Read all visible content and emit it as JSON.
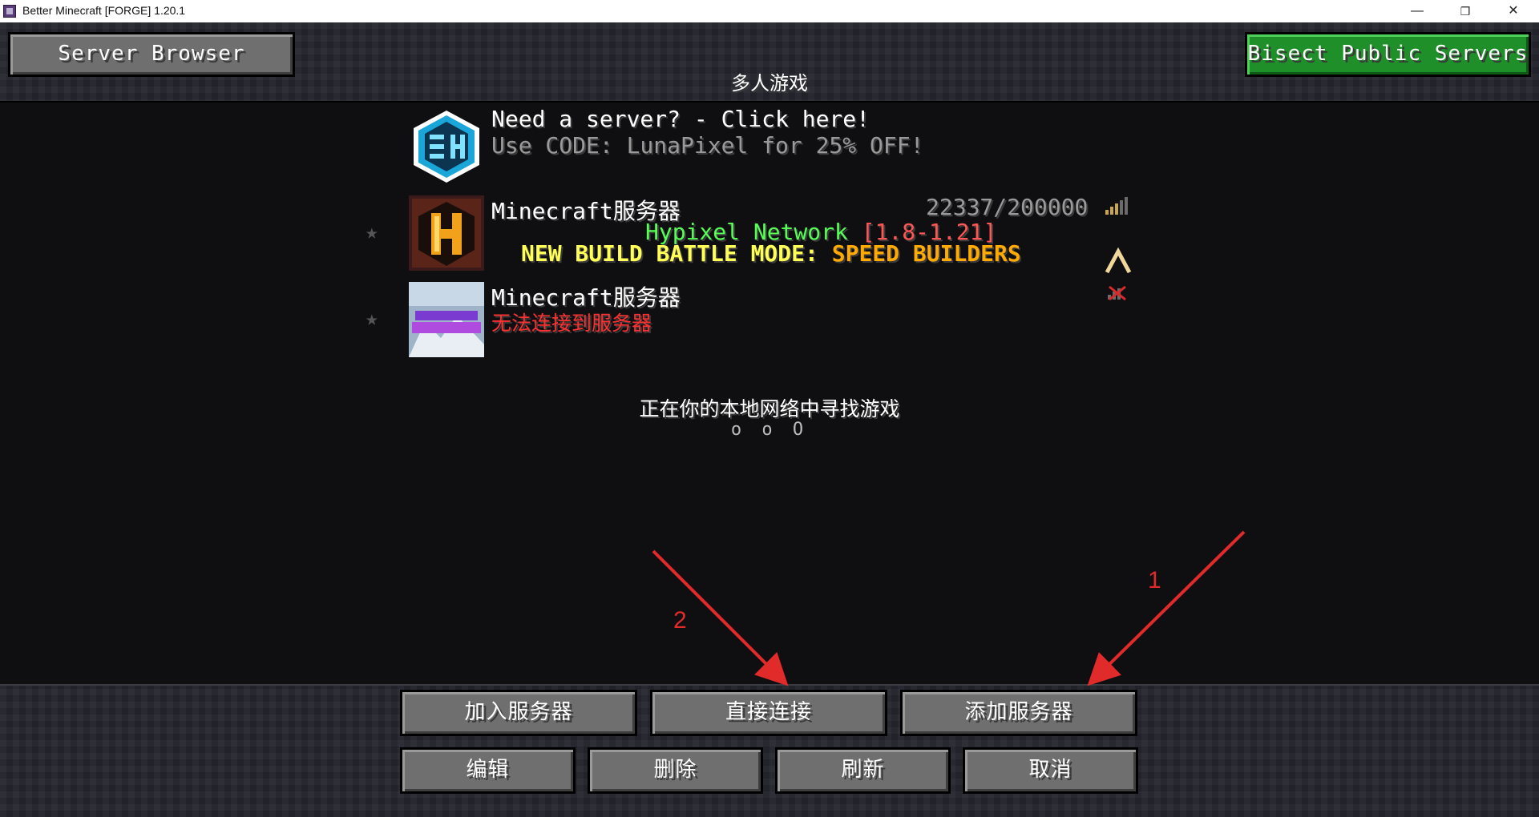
{
  "window": {
    "title": "Better Minecraft [FORGE] 1.20.1",
    "minimize": "—",
    "restore": "❐",
    "close": "✕"
  },
  "header": {
    "server_browser_label": "Server Browser",
    "bisect_label": "Bisect Public Servers",
    "screen_title": "多人游戏"
  },
  "ad": {
    "line1": "Need a server? - Click here!",
    "line2": "Use CODE: LunaPixel for 25% OFF!",
    "icon": "bisecthosting-logo-icon"
  },
  "servers": [
    {
      "name": "Minecraft服务器",
      "players": "22337/200000",
      "motd_network": "Hypixel Network",
      "motd_version": "[1.8-1.21]",
      "motd_line2_a": "NEW BUILD BATTLE MODE:",
      "motd_line2_b": "SPEED BUILDERS",
      "status_icon": "signal-bars-icon",
      "icon": "hypixel-logo-icon"
    },
    {
      "name": "Minecraft服务器",
      "error": "无法连接到服务器",
      "status_icon": "no-connection-icon",
      "icon": "better-minecraft-icon"
    }
  ],
  "lan": {
    "searching": "正在你的本地网络中寻找游戏",
    "dots": "o o O"
  },
  "annotations": {
    "one": "1",
    "two": "2"
  },
  "buttons": {
    "join": "加入服务器",
    "direct": "直接连接",
    "add": "添加服务器",
    "edit": "编辑",
    "delete": "删除",
    "refresh": "刷新",
    "cancel": "取消"
  },
  "colors": {
    "network": "#55ff55",
    "version": "#ff5555",
    "yellow": "#ffff55",
    "gold": "#ffaa00",
    "error": "#ff3030",
    "annotation": "#e12b2b"
  }
}
